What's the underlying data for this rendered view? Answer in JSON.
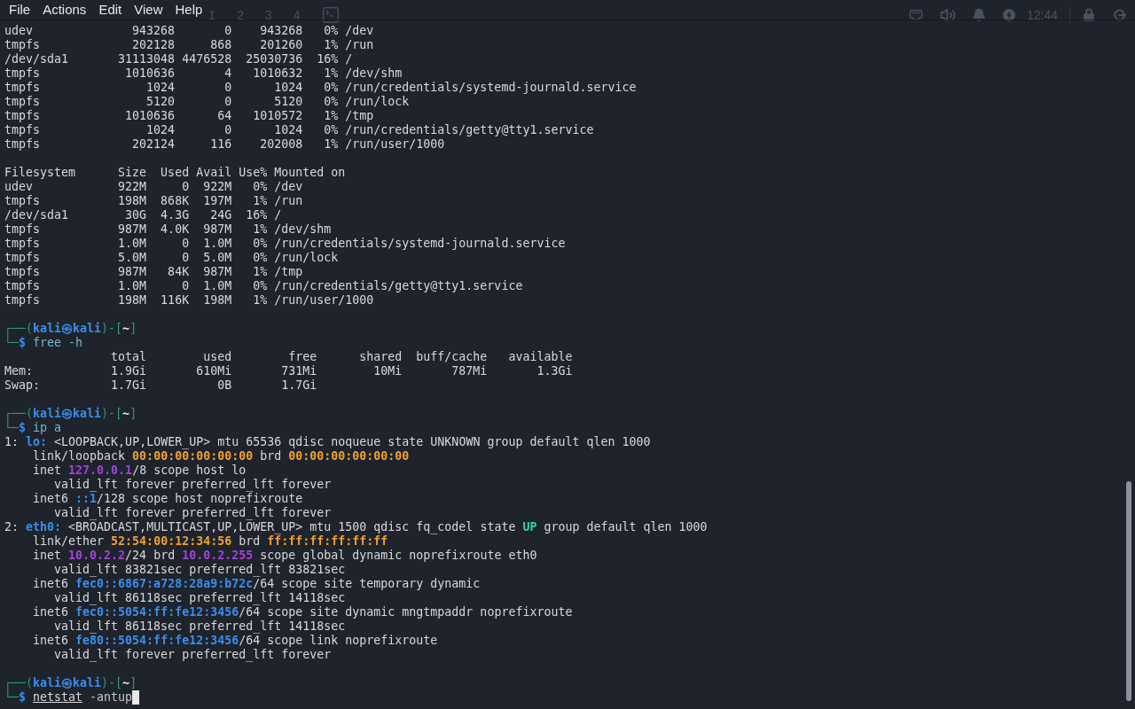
{
  "menu_bar": {
    "items": [
      "File",
      "Actions",
      "Edit",
      "View",
      "Help"
    ]
  },
  "panel": {
    "workspaces": [
      "1",
      "2",
      "3",
      "4"
    ],
    "clock": "12:44"
  },
  "terminal": {
    "cursor_visible": true,
    "blocks": [
      {
        "lines": [
          {
            "text": "udev              943268       0    943268   0% /dev"
          },
          {
            "text": "tmpfs             202128     868    201260   1% /run"
          },
          {
            "text": "/dev/sda1       31113048 4476528  25030736  16% /"
          },
          {
            "text": "tmpfs            1010636       4   1010632   1% /dev/shm"
          },
          {
            "text": "tmpfs               1024       0      1024   0% /run/credentials/systemd-journald.service"
          },
          {
            "text": "tmpfs               5120       0      5120   0% /run/lock"
          },
          {
            "text": "tmpfs            1010636      64   1010572   1% /tmp"
          },
          {
            "text": "tmpfs               1024       0      1024   0% /run/credentials/getty@tty1.service"
          },
          {
            "text": "tmpfs             202124     116    202008   1% /run/user/1000"
          }
        ]
      },
      {
        "lines": [
          {
            "text": "Filesystem      Size  Used Avail Use% Mounted on"
          },
          {
            "text": "udev            922M     0  922M   0% /dev"
          },
          {
            "text": "tmpfs           198M  868K  197M   1% /run"
          },
          {
            "text": "/dev/sda1        30G  4.3G   24G  16% /"
          },
          {
            "text": "tmpfs           987M  4.0K  987M   1% /dev/shm"
          },
          {
            "text": "tmpfs           1.0M     0  1.0M   0% /run/credentials/systemd-journald.service"
          },
          {
            "text": "tmpfs           5.0M     0  5.0M   0% /run/lock"
          },
          {
            "text": "tmpfs           987M   84K  987M   1% /tmp"
          },
          {
            "text": "tmpfs           1.0M     0  1.0M   0% /run/credentials/getty@tty1.service"
          },
          {
            "text": "tmpfs           198M  116K  198M   1% /run/user/1000"
          }
        ]
      },
      {
        "lines": [
          {
            "parts": [
              {
                "text": "┌──(",
                "kind": "frame"
              },
              {
                "text": "kali㉿kali",
                "kind": "user"
              },
              {
                "text": ")-[",
                "kind": "frame"
              },
              {
                "text": "~",
                "kind": "cwd"
              },
              {
                "text": "]",
                "kind": "frame"
              }
            ]
          },
          {
            "parts": [
              {
                "text": "└─",
                "kind": "frame"
              },
              {
                "text": "$ ",
                "kind": "dollar"
              },
              {
                "text": "free -h",
                "kind": "command"
              }
            ]
          },
          {
            "text": "               total        used        free      shared  buff/cache   available"
          },
          {
            "text": "Mem:           1.9Gi       610Mi       731Mi        10Mi       787Mi       1.3Gi"
          },
          {
            "text": "Swap:          1.7Gi          0B       1.7Gi"
          }
        ]
      },
      {
        "lines": [
          {
            "parts": [
              {
                "text": "┌──(",
                "kind": "frame"
              },
              {
                "text": "kali㉿kali",
                "kind": "user"
              },
              {
                "text": ")-[",
                "kind": "frame"
              },
              {
                "text": "~",
                "kind": "cwd"
              },
              {
                "text": "]",
                "kind": "frame"
              }
            ]
          },
          {
            "parts": [
              {
                "text": "└─",
                "kind": "frame"
              },
              {
                "text": "$ ",
                "kind": "dollar"
              },
              {
                "text": "ip a",
                "kind": "command"
              }
            ]
          },
          {
            "parts": [
              {
                "text": "1: ",
                "kind": "plain"
              },
              {
                "text": "lo:",
                "kind": "iface"
              },
              {
                "text": " <LOOPBACK,UP,LOWER_UP> mtu 65536 qdisc noqueue state UNKNOWN group default qlen 1000",
                "kind": "plain"
              }
            ]
          },
          {
            "parts": [
              {
                "text": "    link/loopback ",
                "kind": "plain"
              },
              {
                "text": "00:00:00:00:00:00",
                "kind": "mac"
              },
              {
                "text": " brd ",
                "kind": "plain"
              },
              {
                "text": "00:00:00:00:00:00",
                "kind": "mac"
              }
            ]
          },
          {
            "parts": [
              {
                "text": "    inet ",
                "kind": "plain"
              },
              {
                "text": "127.0.0.1",
                "kind": "ipv4"
              },
              {
                "text": "/8 scope host lo",
                "kind": "plain"
              }
            ]
          },
          {
            "text": "       valid_lft forever preferred_lft forever"
          },
          {
            "parts": [
              {
                "text": "    inet6 ",
                "kind": "plain"
              },
              {
                "text": "::1",
                "kind": "ipv6"
              },
              {
                "text": "/128 scope host noprefixroute",
                "kind": "plain"
              }
            ]
          },
          {
            "text": "       valid_lft forever preferred_lft forever"
          },
          {
            "parts": [
              {
                "text": "2: ",
                "kind": "plain"
              },
              {
                "text": "eth0:",
                "kind": "iface"
              },
              {
                "text": " <BROADCAST,MULTICAST,UP,LOWER_UP> mtu 1500 qdisc fq_codel state ",
                "kind": "plain"
              },
              {
                "text": "UP",
                "kind": "state_up"
              },
              {
                "text": " group default qlen 1000",
                "kind": "plain"
              }
            ]
          },
          {
            "parts": [
              {
                "text": "    link/ether ",
                "kind": "plain"
              },
              {
                "text": "52:54:00:12:34:56",
                "kind": "mac"
              },
              {
                "text": " brd ",
                "kind": "plain"
              },
              {
                "text": "ff:ff:ff:ff:ff:ff",
                "kind": "mac"
              }
            ]
          },
          {
            "parts": [
              {
                "text": "    inet ",
                "kind": "plain"
              },
              {
                "text": "10.0.2.2",
                "kind": "ipv4"
              },
              {
                "text": "/24 brd ",
                "kind": "plain"
              },
              {
                "text": "10.0.2.255",
                "kind": "ipv4"
              },
              {
                "text": " scope global dynamic noprefixroute eth0",
                "kind": "plain"
              }
            ]
          },
          {
            "text": "       valid_lft 83821sec preferred_lft 83821sec"
          },
          {
            "parts": [
              {
                "text": "    inet6 ",
                "kind": "plain"
              },
              {
                "text": "fec0::6867:a728:28a9:b72c",
                "kind": "ipv6"
              },
              {
                "text": "/64 scope site temporary dynamic",
                "kind": "plain"
              }
            ]
          },
          {
            "text": "       valid_lft 86118sec preferred_lft 14118sec"
          },
          {
            "parts": [
              {
                "text": "    inet6 ",
                "kind": "plain"
              },
              {
                "text": "fec0::5054:ff:fe12:3456",
                "kind": "ipv6"
              },
              {
                "text": "/64 scope site dynamic mngtmpaddr noprefixroute",
                "kind": "plain"
              }
            ]
          },
          {
            "text": "       valid_lft 86118sec preferred_lft 14118sec"
          },
          {
            "parts": [
              {
                "text": "    inet6 ",
                "kind": "plain"
              },
              {
                "text": "fe80::5054:ff:fe12:3456",
                "kind": "ipv6"
              },
              {
                "text": "/64 scope link noprefixroute",
                "kind": "plain"
              }
            ]
          },
          {
            "text": "       valid_lft forever preferred_lft forever"
          }
        ]
      },
      {
        "lines": [
          {
            "parts": [
              {
                "text": "┌──(",
                "kind": "frame"
              },
              {
                "text": "kali㉿kali",
                "kind": "user"
              },
              {
                "text": ")-[",
                "kind": "frame"
              },
              {
                "text": "~",
                "kind": "cwd"
              },
              {
                "text": "]",
                "kind": "frame"
              }
            ]
          },
          {
            "parts": [
              {
                "text": "└─",
                "kind": "frame"
              },
              {
                "text": "$ ",
                "kind": "dollar"
              },
              {
                "text": "netstat",
                "kind": "path"
              },
              {
                "text": " -antup",
                "kind": "arg"
              }
            ]
          }
        ]
      }
    ]
  }
}
